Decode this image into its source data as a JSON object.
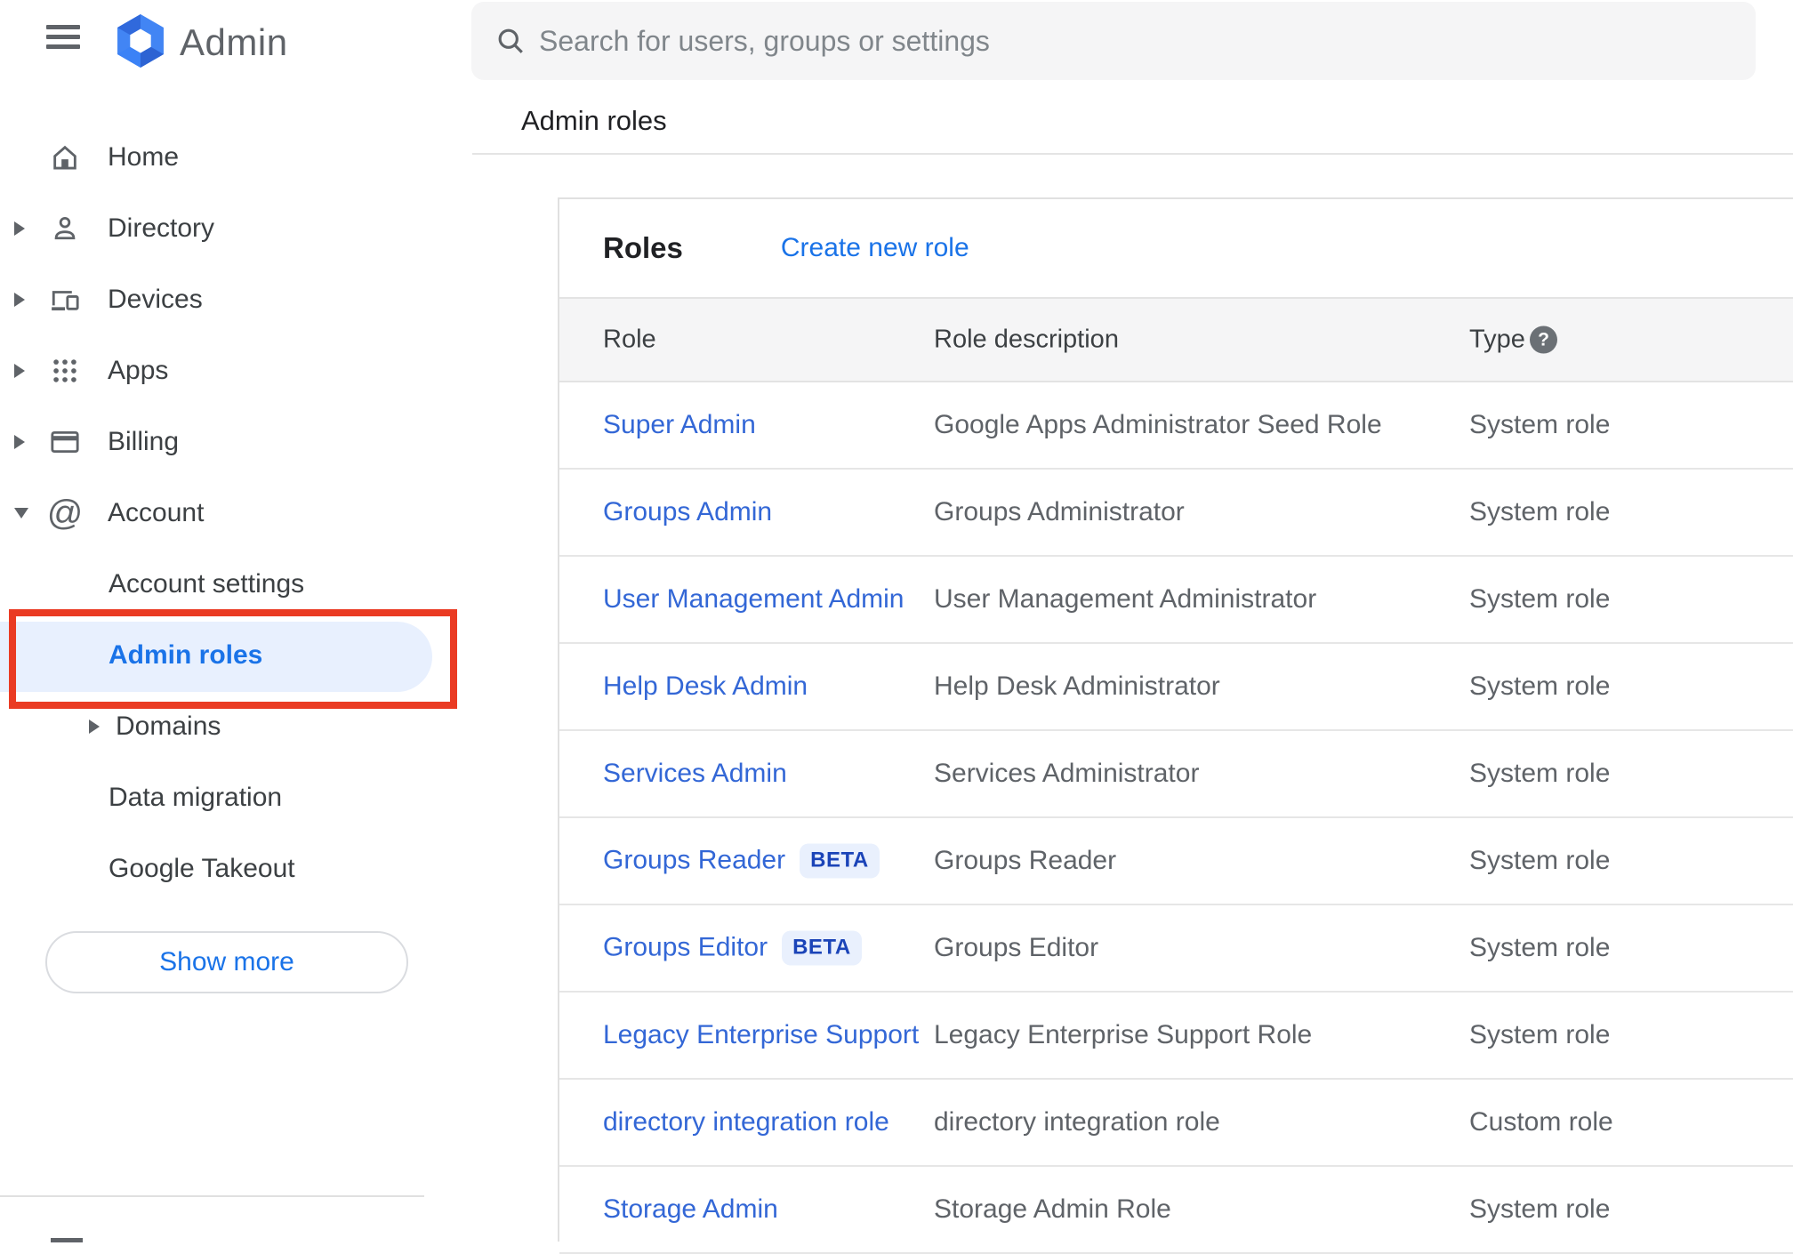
{
  "topbar": {
    "product_name": "Admin",
    "search": {
      "placeholder": "Search for users, groups or settings"
    }
  },
  "breadcrumb": {
    "title": "Admin roles"
  },
  "sidebar": {
    "items": [
      {
        "label": "Home",
        "icon": "home-icon",
        "expandable": false
      },
      {
        "label": "Directory",
        "icon": "person-icon",
        "expandable": true
      },
      {
        "label": "Devices",
        "icon": "devices-icon",
        "expandable": true
      },
      {
        "label": "Apps",
        "icon": "apps-grid-icon",
        "expandable": true
      },
      {
        "label": "Billing",
        "icon": "credit-card-icon",
        "expandable": true
      },
      {
        "label": "Account",
        "icon": "at-sign-icon",
        "expandable": true,
        "expanded": true
      }
    ],
    "account_children": [
      {
        "label": "Account settings",
        "selected": false
      },
      {
        "label": "Admin roles",
        "selected": true
      },
      {
        "label": "Domains",
        "expandable": true,
        "selected": false
      },
      {
        "label": "Data migration",
        "selected": false
      },
      {
        "label": "Google Takeout",
        "selected": false
      }
    ],
    "show_more_label": "Show more"
  },
  "annotation": {
    "shape": "red-highlight-box",
    "target": "Admin roles",
    "color": "#ea3b23"
  },
  "roles": {
    "title": "Roles",
    "create_link": "Create new role",
    "columns": {
      "role": "Role",
      "description": "Role description",
      "type": "Type"
    },
    "help_icon_glyph": "?",
    "rows": [
      {
        "name": "Super Admin",
        "badge": "",
        "description": "Google Apps Administrator Seed Role",
        "type": "System role"
      },
      {
        "name": "Groups Admin",
        "badge": "",
        "description": "Groups Administrator",
        "type": "System role"
      },
      {
        "name": "User Management Admin",
        "badge": "",
        "description": "User Management Administrator",
        "type": "System role"
      },
      {
        "name": "Help Desk Admin",
        "badge": "",
        "description": "Help Desk Administrator",
        "type": "System role"
      },
      {
        "name": "Services Admin",
        "badge": "",
        "description": "Services Administrator",
        "type": "System role"
      },
      {
        "name": "Groups Reader",
        "badge": "BETA",
        "description": "Groups Reader",
        "type": "System role"
      },
      {
        "name": "Groups Editor",
        "badge": "BETA",
        "description": "Groups Editor",
        "type": "System role"
      },
      {
        "name": "Legacy Enterprise Support",
        "badge": "",
        "description": "Legacy Enterprise Support Role",
        "type": "System role"
      },
      {
        "name": "directory integration role",
        "badge": "",
        "description": "directory integration role",
        "type": "Custom role"
      },
      {
        "name": "Storage Admin",
        "badge": "",
        "description": "Storage Admin Role",
        "type": "System role"
      }
    ]
  },
  "colors": {
    "accent_blue": "#1a73e8",
    "table_link_blue": "#3367d6",
    "selected_item_bg": "#e8f0fe",
    "annotation_red": "#ea3b23",
    "beta_badge_bg": "#e9f0fd",
    "beta_badge_text": "#1b44b8",
    "header_band_bg": "#f5f5f6",
    "search_bar_bg": "#f5f5f6",
    "icon_gray": "#5f6368",
    "text_dark": "#202124"
  }
}
